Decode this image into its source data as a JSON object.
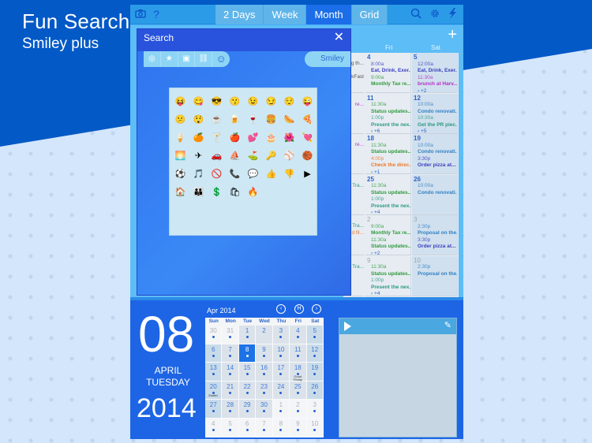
{
  "promo": {
    "title": "Fun Search",
    "subtitle": "Smiley plus"
  },
  "toolbar": {
    "left_icons": [
      "camera-icon",
      "help-icon"
    ],
    "help_label": "?",
    "views": [
      {
        "label": "2 Days",
        "active": false
      },
      {
        "label": "Week",
        "active": false
      },
      {
        "label": "Month",
        "active": true
      },
      {
        "label": "Grid",
        "active": false
      }
    ],
    "right_icons": [
      "search-icon",
      "gear-icon",
      "lightning-icon"
    ]
  },
  "search_panel": {
    "title": "Search",
    "close_label": "✕",
    "filter_icons": [
      "search-filter-icon",
      "star-icon",
      "calendar-icon",
      "link-icon",
      "smiley-icon"
    ],
    "active_filter": "Smiley",
    "emojis": [
      "😝",
      "😋",
      "😎",
      "😗",
      "😉",
      "😏",
      "😌",
      "😜",
      "😕",
      "😲",
      "☕",
      "🍺",
      "🍷",
      "🍔",
      "🌭",
      "🍕",
      "🍦",
      "🍊",
      "🍸",
      "🍎",
      "💕",
      "🎂",
      "🌺",
      "💘",
      "🌅",
      "✈",
      "🚗",
      "⛵",
      "⛳",
      "🔑",
      "⚾",
      "🏀",
      "⚽",
      "🎵",
      "🚫",
      "📞",
      "💬",
      "👍",
      "👎",
      "▶",
      "🏠",
      "👪",
      "💲",
      "🛍",
      "🔥"
    ]
  },
  "calendar": {
    "add_label": "+",
    "day_headers": [
      "Fri",
      "Sat"
    ],
    "weeks": [
      {
        "partial": [
          "g th...",
          "",
          "kFast"
        ],
        "fri": {
          "day": "4",
          "events": [
            {
              "time": "8:00a",
              "title": "Eat, Drink, Exer...",
              "color": "#3a3fbf"
            },
            {
              "time": "9:00a",
              "title": "Monthly Tax re...",
              "color": "#2e9a3c"
            }
          ],
          "more": ""
        },
        "sat": {
          "day": "5",
          "events": [
            {
              "time": "12:00a",
              "title": "Eat, Drink, Exer...",
              "color": "#3a3fbf"
            },
            {
              "time": "11:30a",
              "title": "brunch at Harv...",
              "color": "#b52dc7"
            }
          ],
          "more": "+2"
        }
      },
      {
        "partial": [
          "re..."
        ],
        "fri": {
          "day": "11",
          "events": [
            {
              "time": "11:30a",
              "title": "Status updates...",
              "color": "#2e9a3c"
            },
            {
              "time": "1:00p",
              "title": "Present the nex...",
              "color": "#2a9a80"
            }
          ],
          "more": "+6"
        },
        "sat": {
          "day": "12",
          "events": [
            {
              "time": "10:00a",
              "title": "Condo renovati...",
              "color": "#2e7fc4"
            },
            {
              "time": "10:30a",
              "title": "Get the PR piec...",
              "color": "#2a9a80"
            }
          ],
          "more": "+5"
        }
      },
      {
        "partial": [
          "re..."
        ],
        "fri": {
          "day": "18",
          "events": [
            {
              "time": "11:30a",
              "title": "Status updates...",
              "color": "#2e9a3c"
            },
            {
              "time": "4:00p",
              "title": "Check the direc...",
              "color": "#e9782a"
            }
          ],
          "more": "+1"
        },
        "sat": {
          "day": "19",
          "events": [
            {
              "time": "10:00a",
              "title": "Condo renovati...",
              "color": "#2e7fc4"
            },
            {
              "time": "3:30p",
              "title": "Order pizza at...",
              "color": "#3a3fbf"
            }
          ],
          "more": ""
        }
      },
      {
        "partial": [
          "Tra..."
        ],
        "fri": {
          "day": "25",
          "events": [
            {
              "time": "11:30a",
              "title": "Status updates...",
              "color": "#2e9a3c"
            },
            {
              "time": "1:00p",
              "title": "Present the nex...",
              "color": "#2a9a80"
            }
          ],
          "more": "+4"
        },
        "sat": {
          "day": "26",
          "events": [
            {
              "time": "10:00a",
              "title": "Condo renovati...",
              "color": "#2e7fc4"
            }
          ],
          "more": ""
        }
      },
      {
        "partial": [
          "Tra...",
          "d fil..."
        ],
        "fri": {
          "day": "2",
          "dim": true,
          "events": [
            {
              "time": "9:00a",
              "title": "Monthly Tax re...",
              "color": "#2e9a3c"
            },
            {
              "time": "11:30a",
              "title": "Status updates...",
              "color": "#2e9a3c"
            }
          ],
          "more": "+2"
        },
        "sat": {
          "day": "3",
          "dim": true,
          "events": [
            {
              "time": "2:30p",
              "title": "Proposal on the...",
              "color": "#2e7fc4"
            },
            {
              "time": "3:30p",
              "title": "Order pizza at...",
              "color": "#3a3fbf"
            }
          ],
          "more": ""
        }
      },
      {
        "partial": [
          "Tra..."
        ],
        "fri": {
          "day": "9",
          "dim": true,
          "events": [
            {
              "time": "11:30a",
              "title": "Status updates...",
              "color": "#2e9a3c"
            },
            {
              "time": "1:00p",
              "title": "Present the nex...",
              "color": "#2a9a80"
            }
          ],
          "more": "+4"
        },
        "sat": {
          "day": "10",
          "dim": true,
          "events": [
            {
              "time": "2:30p",
              "title": "Proposal on the...",
              "color": "#2e7fc4"
            }
          ],
          "more": ""
        }
      }
    ]
  },
  "today": {
    "day": "08",
    "month": "APRIL",
    "weekday": "TUESDAY",
    "year": "2014"
  },
  "mini_calendar": {
    "title": "Apr 2014",
    "nav": {
      "prev": "‹",
      "today": "H",
      "next": "›"
    },
    "headers": [
      "Sun",
      "Mon",
      "Tue",
      "Wed",
      "Thu",
      "Fri",
      "Sat"
    ],
    "rows": [
      [
        {
          "d": "30",
          "out": true
        },
        {
          "d": "31",
          "out": true
        },
        {
          "d": "1"
        },
        {
          "d": "2",
          "nodot": true
        },
        {
          "d": "3"
        },
        {
          "d": "4"
        },
        {
          "d": "5"
        }
      ],
      [
        {
          "d": "6"
        },
        {
          "d": "7"
        },
        {
          "d": "8",
          "sel": true
        },
        {
          "d": "9"
        },
        {
          "d": "10"
        },
        {
          "d": "11"
        },
        {
          "d": "12"
        }
      ],
      [
        {
          "d": "13"
        },
        {
          "d": "14"
        },
        {
          "d": "15"
        },
        {
          "d": "16"
        },
        {
          "d": "17"
        },
        {
          "d": "18",
          "hol": "Good Friday"
        },
        {
          "d": "19"
        }
      ],
      [
        {
          "d": "20",
          "hol": "Easter"
        },
        {
          "d": "21"
        },
        {
          "d": "22"
        },
        {
          "d": "23"
        },
        {
          "d": "24"
        },
        {
          "d": "25"
        },
        {
          "d": "26"
        }
      ],
      [
        {
          "d": "27"
        },
        {
          "d": "28"
        },
        {
          "d": "29"
        },
        {
          "d": "30"
        },
        {
          "d": "1",
          "out": true
        },
        {
          "d": "2",
          "out": true
        },
        {
          "d": "3",
          "out": true
        }
      ],
      [
        {
          "d": "4",
          "out": true
        },
        {
          "d": "5",
          "out": true
        },
        {
          "d": "6",
          "out": true
        },
        {
          "d": "7",
          "out": true
        },
        {
          "d": "8",
          "out": true
        },
        {
          "d": "9",
          "out": true
        },
        {
          "d": "10",
          "out": true
        }
      ]
    ]
  },
  "player": {
    "icons": [
      "play-icon",
      "pen-icon"
    ]
  }
}
